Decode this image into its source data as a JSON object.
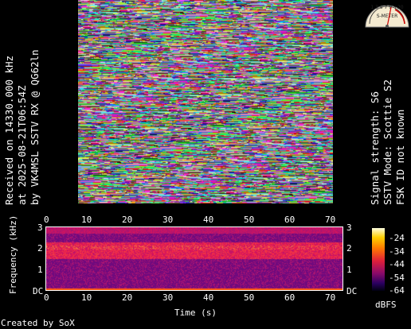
{
  "left_info": {
    "line1": "Received on  14330.000 kHz",
    "line2": "at 2025-08-21T06:54Z",
    "line3": "by VK4MSL SSTV RX @ QG62ln"
  },
  "right_info": {
    "line1": "Signal strength: S6",
    "line2": "SSTV Mode: Scottie S2",
    "line3": "FSK ID not known"
  },
  "meter": {
    "scale": "1 3 5 7 9 +20",
    "label": "S-METER",
    "reading": "S6"
  },
  "spectrogram": {
    "x_ticks": [
      "0",
      "10",
      "20",
      "30",
      "40",
      "50",
      "60",
      "70"
    ],
    "y_ticks": [
      "3",
      "2",
      "1",
      "DC"
    ],
    "xlabel": "Time (s)",
    "ylabel": "Frequency (kHz)"
  },
  "colorbar": {
    "ticks": [
      "-24",
      "-34",
      "-44",
      "-54",
      "-64"
    ],
    "unit": "dBFS"
  },
  "footer": "Created by SoX",
  "colors": {
    "background": "#000000",
    "text": "#ffffff",
    "spectrum_base": "#5a0a78",
    "spectrum_band": "#e8204a"
  }
}
